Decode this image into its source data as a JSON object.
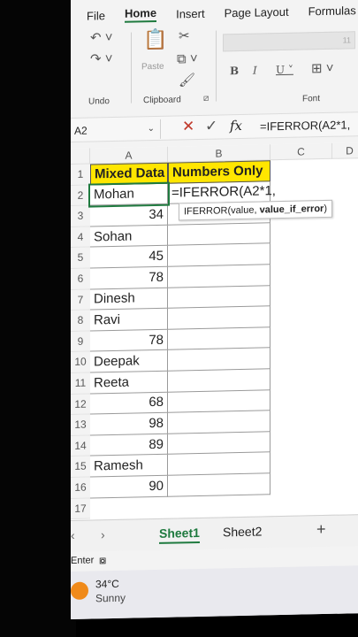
{
  "ribbon": {
    "tabs": [
      "File",
      "Home",
      "Insert",
      "Page Layout",
      "Formulas"
    ],
    "active_tab": "Home",
    "groups": {
      "undo": "Undo",
      "clipboard": "Clipboard",
      "font": "Font"
    },
    "paste_label": "Paste",
    "font_size_value": "11"
  },
  "formula_bar": {
    "name_box": "A2",
    "formula": "=IFERROR(A2*1,"
  },
  "grid": {
    "columns": [
      "A",
      "B",
      "C",
      "D"
    ],
    "rows": [
      "1",
      "2",
      "3",
      "4",
      "5",
      "6",
      "7",
      "8",
      "9",
      "10",
      "11",
      "12",
      "13",
      "14",
      "15",
      "16",
      "17"
    ],
    "header_a": "Mixed Data",
    "header_b": "Numbers Only",
    "data_a": [
      "Mohan",
      "34",
      "Sohan",
      "45",
      "78",
      "Dinesh",
      "Ravi",
      "78",
      "Deepak",
      "Reeta",
      "68",
      "98",
      "89",
      "Ramesh",
      "90"
    ],
    "editing_b2": "=IFERROR(A2*1,",
    "tooltip_func": "IFERROR(value, ",
    "tooltip_arg": "value_if_error",
    "tooltip_close": ")"
  },
  "sheets": {
    "tabs": [
      "Sheet1",
      "Sheet2"
    ],
    "active": "Sheet1",
    "add": "+"
  },
  "status": {
    "mode": "Enter"
  },
  "taskbar": {
    "temperature": "34°C",
    "condition": "Sunny"
  },
  "colors": {
    "accent": "#1f7a3f",
    "header_fill": "#ffe600",
    "sun": "#f08a1a"
  }
}
